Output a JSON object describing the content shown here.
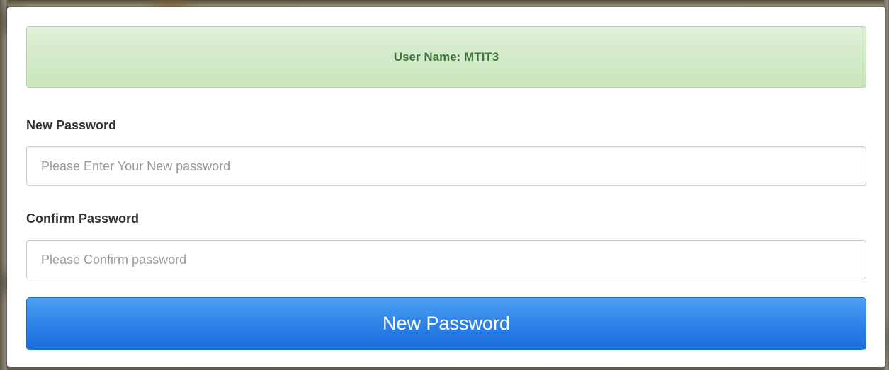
{
  "alert": {
    "text": "User Name: MTIT3",
    "color": "#3c763d",
    "background": "#dff0d8"
  },
  "form": {
    "new_password": {
      "label": "New Password",
      "value": "",
      "placeholder": "Please Enter Your New password"
    },
    "confirm_password": {
      "label": "Confirm Password",
      "value": "",
      "placeholder": "Please Confirm password"
    },
    "submit": {
      "label": "New Password",
      "color": "#2b80e8"
    }
  }
}
